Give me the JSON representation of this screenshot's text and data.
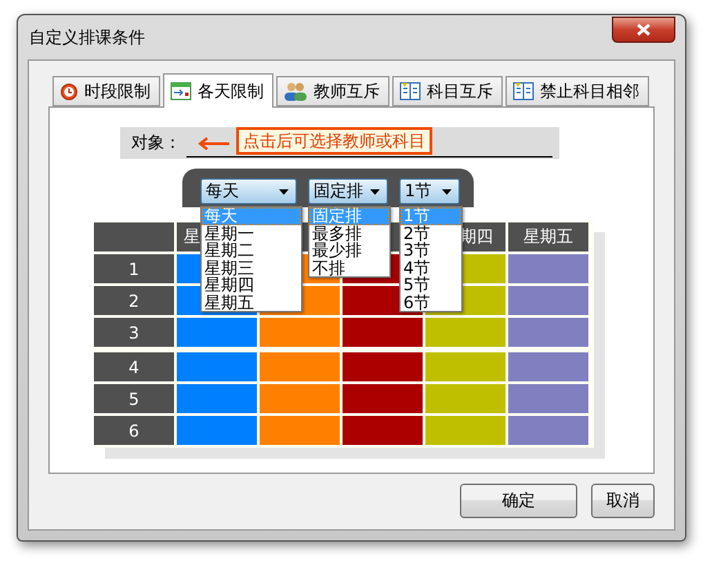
{
  "window": {
    "title": "自定义排课条件"
  },
  "tabs": [
    {
      "label": "时段限制",
      "selected": false
    },
    {
      "label": "各天限制",
      "selected": true
    },
    {
      "label": "教师互斥",
      "selected": false
    },
    {
      "label": "科目互斥",
      "selected": false
    },
    {
      "label": "禁止科目相邻",
      "selected": false
    }
  ],
  "object_field": {
    "label": "对象：",
    "hint": "点击后可选择教师或科目"
  },
  "dropdowns": [
    {
      "value": "每天",
      "expanded": true,
      "options": [
        {
          "label": "每天",
          "selected": true
        },
        {
          "label": "星期一",
          "selected": false
        },
        {
          "label": "星期二",
          "selected": false
        },
        {
          "label": "星期三",
          "selected": false
        },
        {
          "label": "星期四",
          "selected": false
        },
        {
          "label": "星期五",
          "selected": false
        }
      ]
    },
    {
      "value": "固定排",
      "expanded": true,
      "options": [
        {
          "label": "固定排",
          "selected": true
        },
        {
          "label": "最多排",
          "selected": false
        },
        {
          "label": "最少排",
          "selected": false
        },
        {
          "label": "不排",
          "selected": false
        }
      ]
    },
    {
      "value": "1节",
      "expanded": true,
      "options": [
        {
          "label": "1节",
          "selected": true
        },
        {
          "label": "2节",
          "selected": false
        },
        {
          "label": "3节",
          "selected": false
        },
        {
          "label": "4节",
          "selected": false
        },
        {
          "label": "5节",
          "selected": false
        },
        {
          "label": "6节",
          "selected": false
        }
      ]
    }
  ],
  "grid": {
    "columns": [
      {
        "heading": "星",
        "color": "#0080ff"
      },
      {
        "color": "#ff8000"
      },
      {
        "color": "#aa0000"
      },
      {
        "heading": "期四",
        "color": "#bfbf00"
      },
      {
        "heading": "星期五",
        "color": "#8080c0"
      }
    ],
    "row_groups": [
      [
        "1",
        "2",
        "3"
      ],
      [
        "4",
        "5",
        "6"
      ]
    ]
  },
  "buttons": [
    "确定",
    "取消"
  ]
}
